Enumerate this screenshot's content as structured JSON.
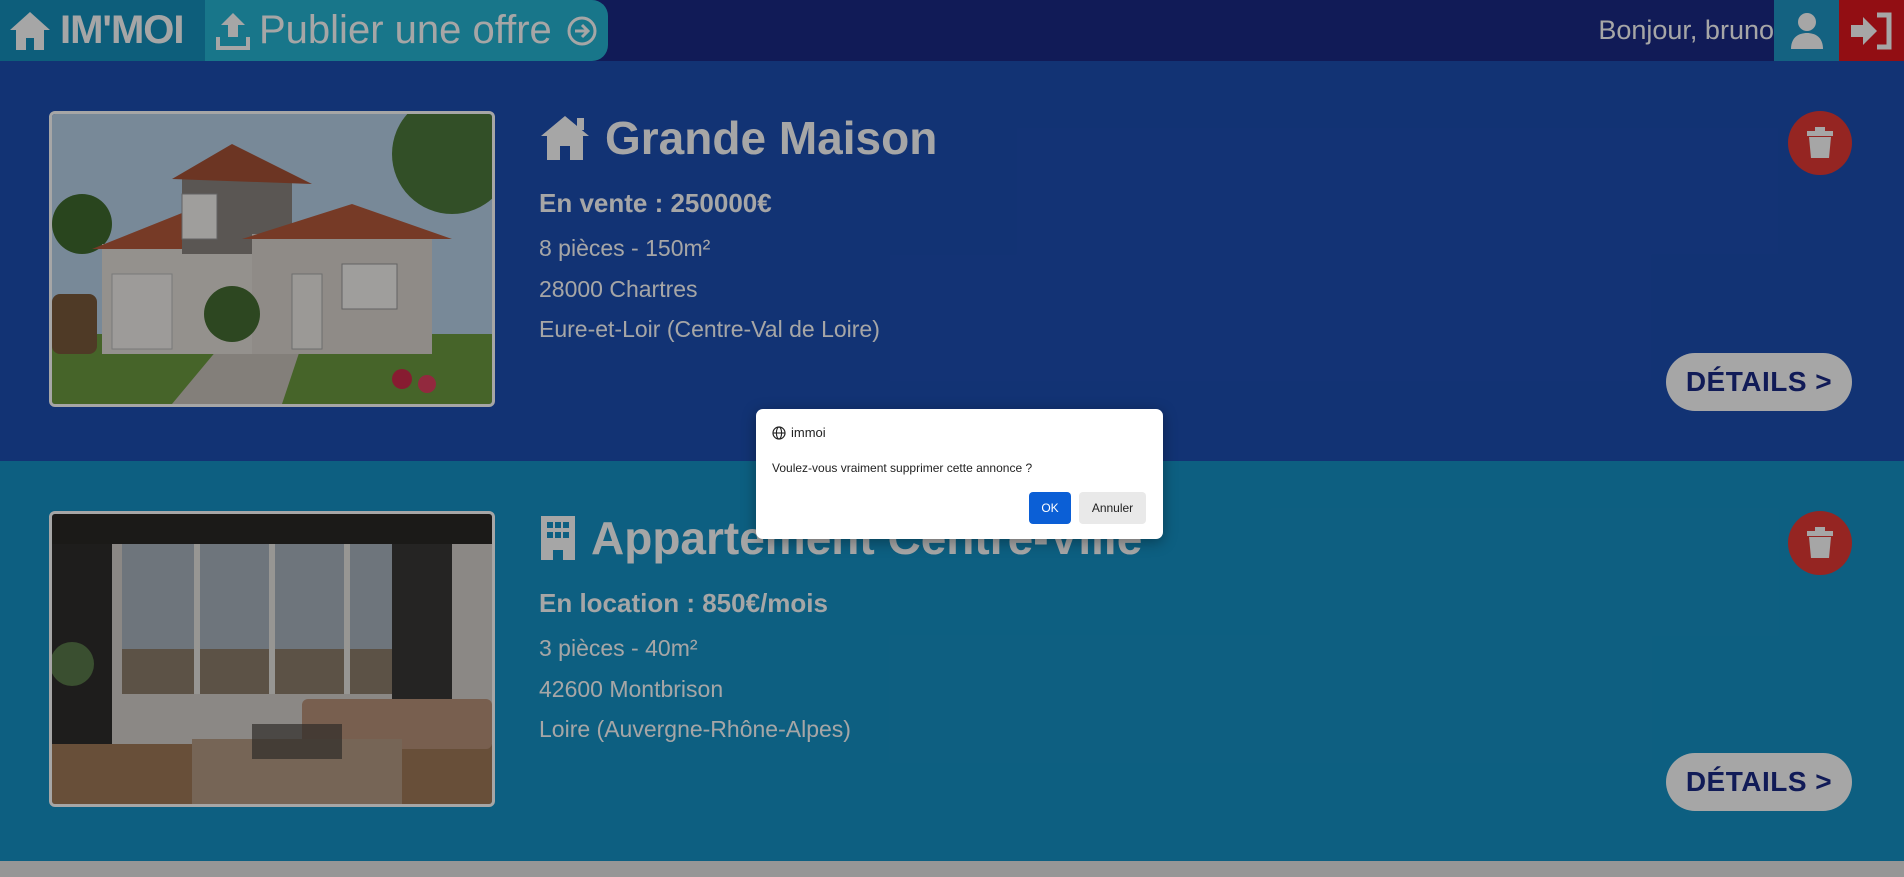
{
  "navbar": {
    "brand": "IM'MOI",
    "publish_label": "Publier une offre",
    "greeting": "Bonjour, bruno"
  },
  "listings": [
    {
      "title": "Grande Maison",
      "type_icon": "house-icon",
      "price": "En vente : 250000€",
      "rooms_area": "8 pièces - 150m²",
      "city": "28000 Chartres",
      "region": "Eure-et-Loir (Centre-Val de Loire)",
      "details_label": "DÉTAILS >"
    },
    {
      "title": "Appartement Centre-Ville",
      "type_icon": "building-icon",
      "price": "En location : 850€/mois",
      "rooms_area": "3 pièces - 40m²",
      "city": "42600 Montbrison",
      "region": "Loire (Auvergne-Rhône-Alpes)",
      "details_label": "DÉTAILS >"
    }
  ],
  "dialog": {
    "site": "immoi",
    "message": "Voulez-vous vraiment supprimer cette annonce ?",
    "ok_label": "OK",
    "cancel_label": "Annuler"
  },
  "colors": {
    "navbar": "#1b2a86",
    "brand": "#1491bd",
    "publish": "#25b6d4",
    "card1": "#1d4fb3",
    "card2": "#1592c6",
    "danger": "#e53935",
    "ok_button": "#0b5fd6"
  }
}
